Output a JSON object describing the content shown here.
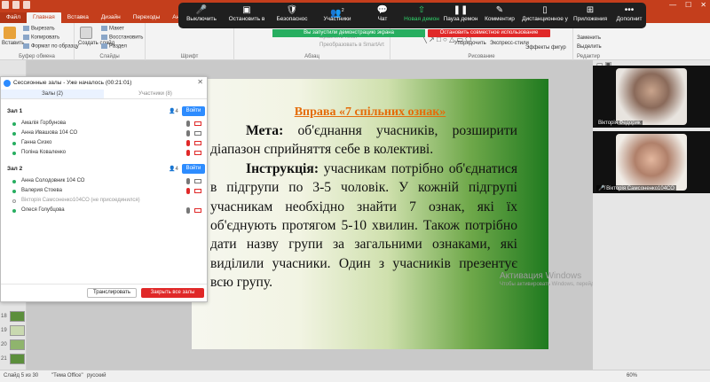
{
  "titlebar": {
    "win_controls": [
      "—",
      "☐",
      "✕"
    ]
  },
  "ribbon_tabs": [
    "Файл",
    "Главная",
    "Вставка",
    "Дизайн",
    "Переходы",
    "Анимация"
  ],
  "ribbon": {
    "paste": "Вставить",
    "cut": "Вырезать",
    "copy": "Копировать",
    "format_painter": "Формат по образцу",
    "new_slide": "Создать слайд",
    "layout": "Макет",
    "reset": "Восстановить",
    "section": "Раздел",
    "group_clipboard": "Буфер обмена",
    "group_slides": "Слайды",
    "group_font": "Шрифт",
    "group_paragraph": "Абзац",
    "group_drawing": "Рисование",
    "group_editing": "Редактир",
    "align_text": "ыравнить текст",
    "convert_smartart": "Преобразовать в SmartArt",
    "arrange": "Упорядочить",
    "quick_styles": "Экспресс-стили",
    "shape_effects": "Эффекты фигур",
    "replace": "Заменить",
    "select": "Выделить"
  },
  "zoom_toolbar": {
    "items": [
      {
        "icon": "🎤",
        "label": "Выключить"
      },
      {
        "icon": "▣",
        "label": "Остановить в"
      },
      {
        "icon": "🛡",
        "label": "Безопаснос"
      },
      {
        "icon": "👥",
        "label": "Участники",
        "count": "2"
      },
      {
        "icon": "💬",
        "label": "Чат"
      },
      {
        "icon": "⇧",
        "label": "Новая демон"
      },
      {
        "icon": "❚❚",
        "label": "Пауза демон"
      },
      {
        "icon": "✎",
        "label": "Комментир"
      },
      {
        "icon": "▯",
        "label": "Дистанционное у"
      },
      {
        "icon": "⊞",
        "label": "Приложения"
      },
      {
        "icon": "•••",
        "label": "Дополнит"
      }
    ]
  },
  "share_banner": "Вы запустили демонстрацию экрана",
  "stop_share": "Остановить совместное использование",
  "panel": {
    "title": "Сессионные залы - Уже началось (00:21:01)",
    "tab_rooms": "Залы (2)",
    "tab_participants": "Участники (8)",
    "rooms": [
      {
        "name": "Зал 1",
        "count": "4",
        "join": "Войти",
        "members": [
          {
            "name": "Амалія Горбунова",
            "status": "joined"
          },
          {
            "name": "Анна Ивашова 104 СО",
            "status": "joined"
          },
          {
            "name": "Ганна Сизко",
            "status": "joined"
          },
          {
            "name": "Поліна Коваленко",
            "status": "joined"
          }
        ]
      },
      {
        "name": "Зал 2",
        "count": "4",
        "join": "Войти",
        "members": [
          {
            "name": "Анна Солодовник 104 СО",
            "status": "joined"
          },
          {
            "name": "Валерия Стоева",
            "status": "joined"
          },
          {
            "name": "Вікторія Самсоненко104СО   (не присоединился)",
            "status": "not_joined"
          },
          {
            "name": "Олеся Голубцова",
            "status": "joined"
          }
        ]
      }
    ],
    "broadcast": "Транслировать",
    "close_all": "Закрыть все залы"
  },
  "slide": {
    "title": "Вправа «7 спільних ознак»",
    "goal_label": "Мета:",
    "goal_text": " об'єднання учасників, розширити діапазон сприйняття себе в колективі.",
    "instr_label": "Інструкція:",
    "instr_text": " учасникам потрібно об'єднатися в підгрупи по 3-5 чоловік. У кожній підгрупі учасникам необхідно знайти 7 ознак, які їх об'єднують протягом 5-10 хвилин. Також потрібно дати назву групи за загальними ознаками, які виділили учасники. Один з учасників презентує всю групу."
  },
  "activation": {
    "title": "Активация Windows",
    "sub": "Чтобы активировать Windows, перейдите в раздел «Параметры»."
  },
  "thumb_numbers": [
    "18",
    "19",
    "20",
    "21"
  ],
  "videos": [
    {
      "name": "Вікторія Федорик",
      "face_color": "#b8907a"
    },
    {
      "name": "Вікторія Самсоненко104СО",
      "face_color": "#d7a88c"
    }
  ],
  "statusbar": {
    "slide": "Слайд 5 из 30",
    "theme": "\"Тема Office\"",
    "lang": "русский",
    "zoom": "60%"
  }
}
